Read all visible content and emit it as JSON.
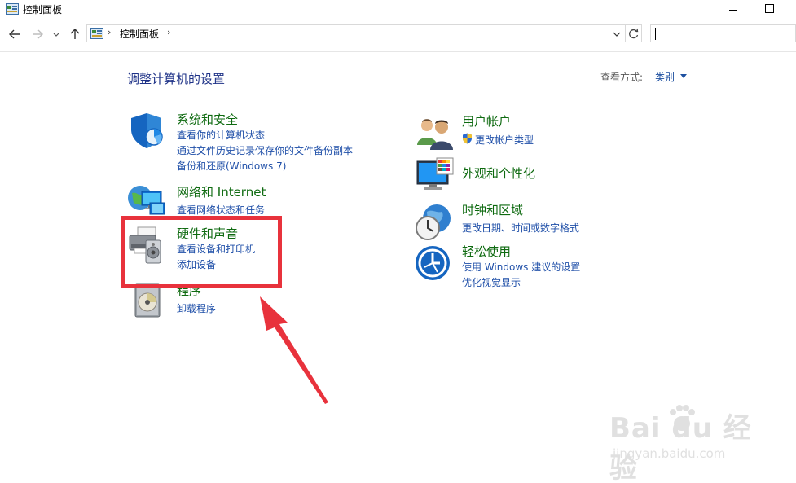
{
  "window": {
    "title": "控制面板"
  },
  "address_bar": {
    "breadcrumb": "控制面板",
    "separator": "›"
  },
  "main": {
    "heading": "调整计算机的设置",
    "view_by_label": "查看方式:",
    "view_by_value": "类别"
  },
  "left_categories": [
    {
      "title": "系统和安全",
      "icon": "security-shield-icon",
      "links": [
        "查看你的计算机状态",
        "通过文件历史记录保存你的文件备份副本",
        "备份和还原(Windows 7)"
      ]
    },
    {
      "title": "网络和 Internet",
      "icon": "network-globe-icon",
      "links": [
        "查看网络状态和任务"
      ]
    },
    {
      "title": "硬件和声音",
      "icon": "printer-speaker-icon",
      "links": [
        "查看设备和打印机",
        "添加设备"
      ]
    },
    {
      "title": "程序",
      "icon": "programs-disc-icon",
      "links": [
        "卸载程序"
      ]
    }
  ],
  "right_categories": [
    {
      "title": "用户帐户",
      "icon": "users-icon",
      "links": [
        "更改帐户类型"
      ]
    },
    {
      "title": "外观和个性化",
      "icon": "monitor-palette-icon",
      "links": []
    },
    {
      "title": "时钟和区域",
      "icon": "clock-globe-icon",
      "links": [
        "更改日期、时间或数字格式"
      ]
    },
    {
      "title": "轻松使用",
      "icon": "ease-of-access-icon",
      "links": [
        "使用 Windows 建议的设置",
        "优化视觉显示"
      ]
    }
  ],
  "annotation": {
    "highlight_color": "#e8323c"
  },
  "watermark": {
    "brand": "Bai du 经验",
    "url": "jingyan.baidu.com"
  },
  "colors": {
    "title_green": "#0e6a10",
    "link_blue": "#1f4fa8",
    "heading_blue": "#1e3287"
  }
}
